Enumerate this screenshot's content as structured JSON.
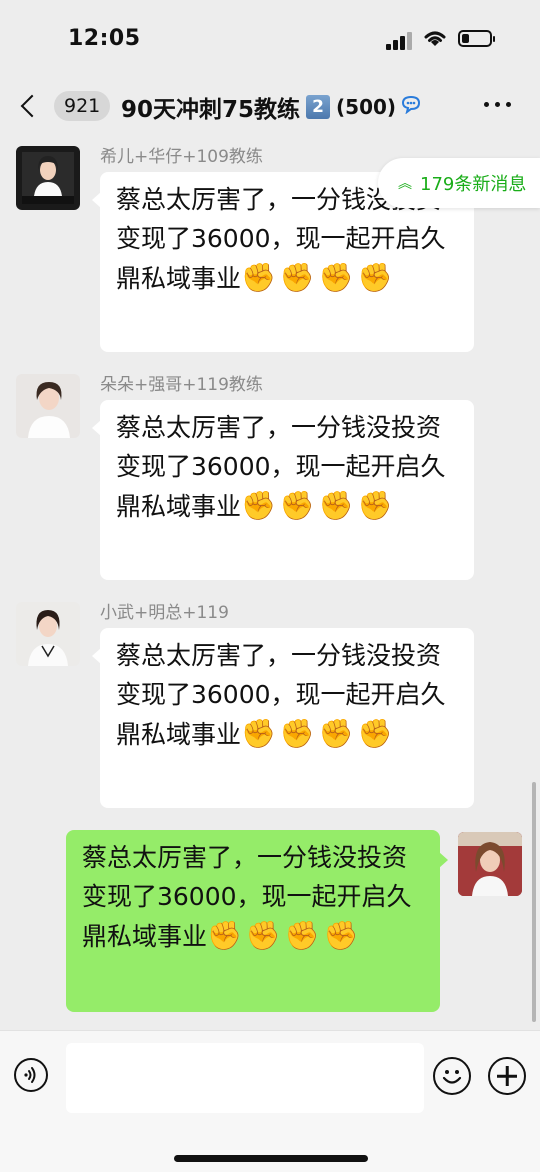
{
  "status_bar": {
    "time": "12:05"
  },
  "header": {
    "unread_count": "921",
    "title": "90天冲刺75教练",
    "badge_number": "2",
    "member_count": "(500)"
  },
  "new_messages": {
    "label": "179条新消息"
  },
  "messages": [
    {
      "sender": "希儿+华仔+109教练",
      "text": "蔡总太厉害了，一分钱没投资变现了36000，现一起开启久鼎私域事业",
      "emoji_count": 4
    },
    {
      "sender": "朵朵+强哥+119教练",
      "text": "蔡总太厉害了，一分钱没投资变现了36000，现一起开启久鼎私域事业",
      "emoji_count": 4
    },
    {
      "sender": "小武+明总+119",
      "text": "蔡总太厉害了，一分钱没投资变现了36000，现一起开启久鼎私域事业",
      "emoji_count": 4
    },
    {
      "sender": "",
      "text": "蔡总太厉害了，一分钱没投资变现了36000，现一起开启久鼎私域事业",
      "emoji_count": 4,
      "outgoing": true
    }
  ],
  "icons": {
    "back": "back-chevron-icon",
    "more": "more-dots-icon",
    "voice": "voice-icon",
    "emoji": "emoji-icon",
    "plus": "plus-icon",
    "emoji_glyph": "fist-emoji"
  },
  "colors": {
    "outgoing_bubble": "#95ec69",
    "incoming_bubble": "#ffffff",
    "background": "#ededed",
    "accent_green": "#1aad19"
  }
}
